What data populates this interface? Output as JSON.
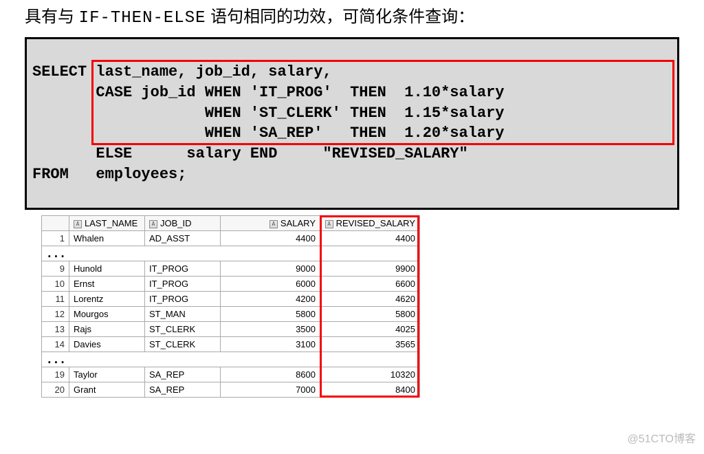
{
  "intro": {
    "before": "具有与",
    "code": "IF-THEN-ELSE",
    "after": " 语句相同的功效，可简化条件查询："
  },
  "sql": {
    "l1": "SELECT last_name, job_id, salary,",
    "l2": "       CASE job_id WHEN 'IT_PROG'  THEN  1.10*salary",
    "l3": "                   WHEN 'ST_CLERK' THEN  1.15*salary",
    "l4": "                   WHEN 'SA_REP'   THEN  1.20*salary",
    "l5": "       ELSE      salary END     \"REVISED_SALARY\"",
    "l6": "FROM   employees;"
  },
  "headers": {
    "h1": "LAST_NAME",
    "h2": "JOB_ID",
    "h3": "SALARY",
    "h4": "REVISED_SALARY"
  },
  "rows1": [
    {
      "n": "1",
      "last": "Whalen",
      "job": "AD_ASST",
      "sal": "4400",
      "rev": "4400"
    }
  ],
  "rows2": [
    {
      "n": "9",
      "last": "Hunold",
      "job": "IT_PROG",
      "sal": "9000",
      "rev": "9900"
    },
    {
      "n": "10",
      "last": "Ernst",
      "job": "IT_PROG",
      "sal": "6000",
      "rev": "6600"
    },
    {
      "n": "11",
      "last": "Lorentz",
      "job": "IT_PROG",
      "sal": "4200",
      "rev": "4620"
    },
    {
      "n": "12",
      "last": "Mourgos",
      "job": "ST_MAN",
      "sal": "5800",
      "rev": "5800"
    },
    {
      "n": "13",
      "last": "Rajs",
      "job": "ST_CLERK",
      "sal": "3500",
      "rev": "4025"
    },
    {
      "n": "14",
      "last": "Davies",
      "job": "ST_CLERK",
      "sal": "3100",
      "rev": "3565"
    }
  ],
  "rows3": [
    {
      "n": "19",
      "last": "Taylor",
      "job": "SA_REP",
      "sal": "8600",
      "rev": "10320"
    },
    {
      "n": "20",
      "last": "Grant",
      "job": "SA_REP",
      "sal": "7000",
      "rev": "8400"
    }
  ],
  "dots": "...",
  "watermark": "@51CTO博客"
}
